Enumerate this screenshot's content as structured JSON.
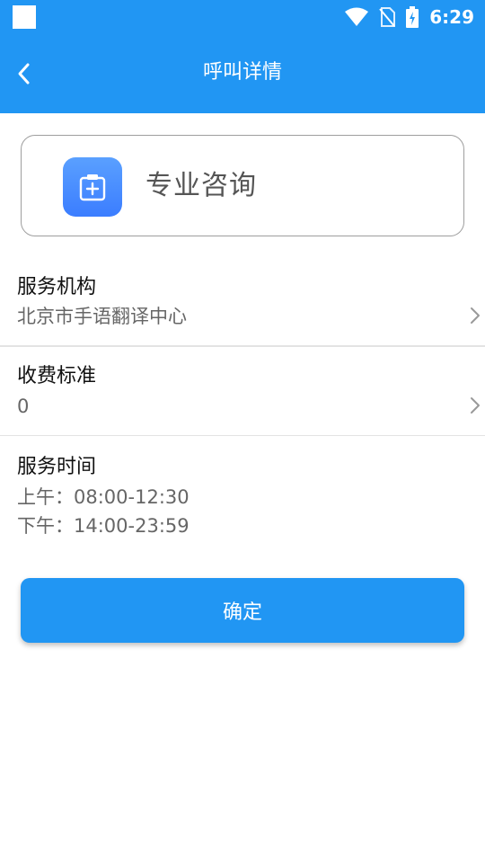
{
  "status_bar": {
    "time": "6:29",
    "icons": [
      "app-square-icon",
      "wifi-icon",
      "no-sim-icon",
      "battery-charging-icon"
    ]
  },
  "header": {
    "title": "呼叫详情",
    "back_icon": "chevron-left-icon",
    "background": "#2196F3"
  },
  "service_card": {
    "icon": "medical-clipboard-icon",
    "name": "专业咨询"
  },
  "rows": {
    "institution": {
      "label": "服务机构",
      "value": "北京市手语翻译中心"
    },
    "fee": {
      "label": "收费标准",
      "value": "0"
    },
    "time": {
      "label": "服务时间",
      "morning": "上午：08:00-12:30",
      "afternoon": "下午：14:00-23:59"
    }
  },
  "confirm_button": {
    "label": "确定"
  }
}
